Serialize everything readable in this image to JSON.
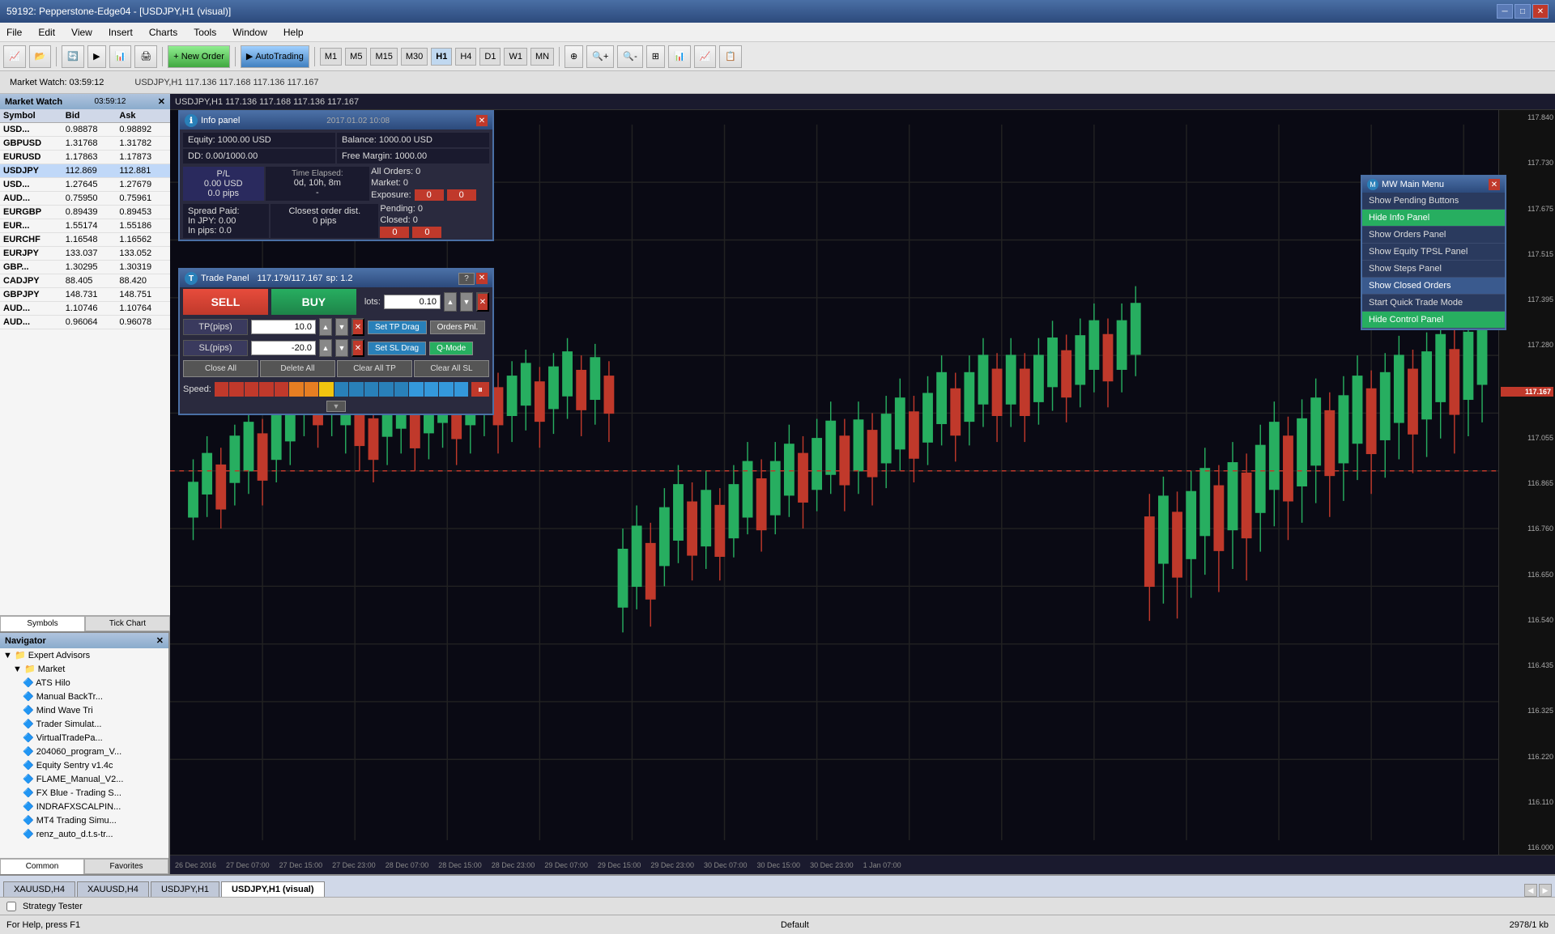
{
  "titleBar": {
    "title": "59192: Pepperstone-Edge04 - [USDJPY,H1 (visual)]",
    "minBtn": "─",
    "maxBtn": "□",
    "closeBtn": "✕"
  },
  "menuBar": {
    "items": [
      "File",
      "Edit",
      "View",
      "Insert",
      "Charts",
      "Tools",
      "Window",
      "Help"
    ]
  },
  "toolbar": {
    "newOrderBtn": "New Order",
    "autoTradingBtn": "AutoTrading",
    "periods": [
      "M1",
      "M5",
      "M15",
      "M30",
      "H1",
      "H4",
      "D1",
      "W1",
      "MN"
    ]
  },
  "toolbar2": {
    "timeDisplay": "Market Watch: 03:59:12",
    "chartInfo": "USDJPY,H1  117.136 117.168 117.136 117.167"
  },
  "marketWatch": {
    "title": "Market Watch",
    "timeDisplay": "03:59:12",
    "columns": [
      "Symbol",
      "Bid",
      "Ask"
    ],
    "rows": [
      {
        "symbol": "USD...",
        "bid": "0.98878",
        "ask": "0.98892",
        "selected": false
      },
      {
        "symbol": "GBPUSD",
        "bid": "1.31768",
        "ask": "1.31782",
        "selected": false
      },
      {
        "symbol": "EURUSD",
        "bid": "1.17863",
        "ask": "1.17873",
        "selected": false
      },
      {
        "symbol": "USDJPY",
        "bid": "112.869",
        "ask": "112.881",
        "selected": true
      },
      {
        "symbol": "USD...",
        "bid": "1.27645",
        "ask": "1.27679",
        "selected": false
      },
      {
        "symbol": "AUD...",
        "bid": "0.75950",
        "ask": "0.75961",
        "selected": false
      },
      {
        "symbol": "EURGBP",
        "bid": "0.89439",
        "ask": "0.89453",
        "selected": false
      },
      {
        "symbol": "EUR...",
        "bid": "1.55174",
        "ask": "1.55186",
        "selected": false
      },
      {
        "symbol": "EURCHF",
        "bid": "1.16548",
        "ask": "1.16562",
        "selected": false
      },
      {
        "symbol": "EURJPY",
        "bid": "133.037",
        "ask": "133.052",
        "selected": false
      },
      {
        "symbol": "GBP...",
        "bid": "1.30295",
        "ask": "1.30319",
        "selected": false
      },
      {
        "symbol": "CADJPY",
        "bid": "88.405",
        "ask": "88.420",
        "selected": false
      },
      {
        "symbol": "GBPJPY",
        "bid": "148.731",
        "ask": "148.751",
        "selected": false
      },
      {
        "symbol": "AUD...",
        "bid": "1.10746",
        "ask": "1.10764",
        "selected": false
      },
      {
        "symbol": "AUD...",
        "bid": "0.96064",
        "ask": "0.96078",
        "selected": false
      }
    ],
    "tabs": [
      "Symbols",
      "Tick Chart",
      "Common",
      "Favorites"
    ]
  },
  "navigator": {
    "title": "Navigator",
    "items": [
      {
        "label": "Expert Advisors",
        "indent": 0
      },
      {
        "label": "Market",
        "indent": 1
      },
      {
        "label": "ATS Hilo",
        "indent": 2
      },
      {
        "label": "Manual BackTr...",
        "indent": 2
      },
      {
        "label": "Mind Wave Tri",
        "indent": 2
      },
      {
        "label": "Trader Simulat...",
        "indent": 2
      },
      {
        "label": "VirtualTradePa...",
        "indent": 2
      },
      {
        "label": "204060_program_V...",
        "indent": 2
      },
      {
        "label": "Equity Sentry v1.4c",
        "indent": 2
      },
      {
        "label": "FLAME_Manual_V2...",
        "indent": 2
      },
      {
        "label": "FX Blue - Trading S...",
        "indent": 2
      },
      {
        "label": "INDRAFXSCALPIN...",
        "indent": 2
      },
      {
        "label": "MT4 Trading Simu...",
        "indent": 2
      },
      {
        "label": "renz_auto_d.t.s-tr...",
        "indent": 2
      }
    ],
    "tabs": [
      "Common",
      "Favorites"
    ]
  },
  "infoPanel": {
    "title": "Info panel",
    "datetime": "2017.01.02 10:08",
    "equity": "Equity: 1000.00 USD",
    "balance": "Balance: 1000.00 USD",
    "dd": "DD: 0.00/1000.00",
    "freeMargin": "Free Margin: 1000.00",
    "plLabel": "P/L",
    "timeElapsedLabel": "Time Elapsed:",
    "timeElapsedVal": "0d, 10h, 8m",
    "plUSD": "0.00 USD",
    "allOrders": "All Orders: 0",
    "market": "Market: 0",
    "plPips": "0.0 pips",
    "exposureLabel": "Exposure:",
    "exposureDash": "-",
    "pending": "Pending: 0",
    "spreadPaid": "Spread Paid:",
    "closedOrders": "Closed: 0",
    "closestOrderDist": "Closest order dist.",
    "inJPY": "In JPY: 0.00",
    "zeroPips": "0 pips",
    "inPips": "In pips: 0.0"
  },
  "tradePanel": {
    "title": "Trade Panel",
    "price": "117.179/117.167",
    "sp": "sp: 1.2",
    "helpBtn": "?",
    "sellBtn": "SELL",
    "buyBtn": "BUY",
    "lotsLabel": "lots:",
    "lotsValue": "0.10",
    "tpLabel": "TP(pips)",
    "tpValue": "10.0",
    "slLabel": "SL(pips)",
    "slValue": "-20.0",
    "setTpDrag": "Set TP Drag",
    "ordersPnl": "Orders Pnl.",
    "setSlDrag": "Set SL Drag",
    "qMode": "Q-Mode",
    "closeAll": "Close All",
    "deleteAll": "Delete All",
    "clearAllTP": "Clear All TP",
    "clearAllSL": "Clear All SL",
    "speedLabel": "Speed:",
    "speedPauseBtn": "⏸",
    "dropdownBtn": "▼"
  },
  "mwMainMenu": {
    "title": "MW Main Menu",
    "items": [
      {
        "label": "Show Pending Buttons",
        "style": "normal"
      },
      {
        "label": "Hide Info Panel",
        "style": "highlight"
      },
      {
        "label": "Show Orders Panel",
        "style": "normal"
      },
      {
        "label": "Show Equity TPSL Panel",
        "style": "normal"
      },
      {
        "label": "Show Steps Panel",
        "style": "normal"
      },
      {
        "label": "Show Closed Orders",
        "style": "hover"
      },
      {
        "label": "Start Quick Trade Mode",
        "style": "normal"
      },
      {
        "label": "Hide Control Panel",
        "style": "highlight"
      }
    ]
  },
  "chartHeader": {
    "title": "USDJPY,H1  117.136 117.168 117.136 117.167"
  },
  "bottomTabs": [
    {
      "label": "XAUUSD,H4",
      "active": false
    },
    {
      "label": "XAUUSD,H4",
      "active": false
    },
    {
      "label": "USDJPY,H1",
      "active": false
    },
    {
      "label": "USDJPY,H1 (visual)",
      "active": true
    }
  ],
  "strategyTester": {
    "label": "Strategy Tester"
  },
  "statusBar": {
    "helpText": "For Help, press F1",
    "mode": "Default",
    "memInfo": "2978/1 kb"
  },
  "priceScale": {
    "prices": [
      "117.840",
      "117.730",
      "117.675",
      "117.515",
      "117.395",
      "117.280",
      "117.167",
      "117.055",
      "116.865",
      "116.760",
      "116.650",
      "116.540",
      "116.435",
      "116.325",
      "116.220",
      "116.110",
      "116.000"
    ],
    "currentPrice": "117.167"
  },
  "timeLabels": [
    "26 Dec 2016",
    "27 Dec 07:00",
    "27 Dec 15:00",
    "27 Dec 23:00",
    "28 Dec 07:00",
    "28 Dec 15:00",
    "28 Dec 23:00",
    "29 Dec 07:00",
    "29 Dec 15:00",
    "29 Dec 23:00",
    "30 Dec 07:00",
    "30 Dec 15:00",
    "30 Dec 23:00",
    "1 Jan 07:00"
  ]
}
